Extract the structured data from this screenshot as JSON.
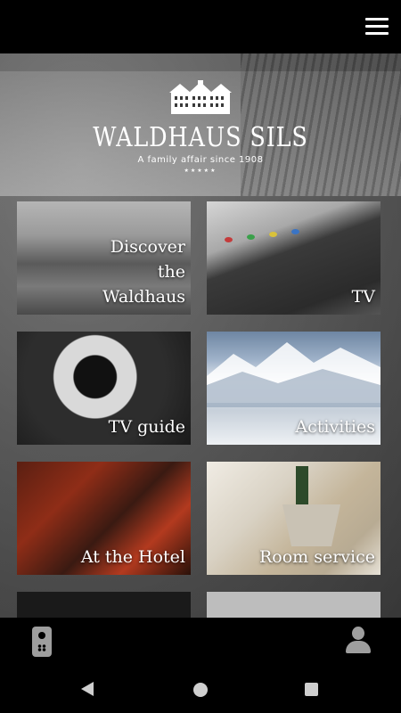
{
  "header": {
    "menu_icon": "hamburger-menu-icon"
  },
  "logo": {
    "brand": "WALDHAUS SILS",
    "tagline": "A family affair since 1908",
    "stars": "★★★★★"
  },
  "tiles": [
    {
      "label": "Discover the Waldhaus"
    },
    {
      "label": "TV"
    },
    {
      "label": "TV guide"
    },
    {
      "label": "Activities"
    },
    {
      "label": "At the Hotel"
    },
    {
      "label": "Room service"
    }
  ],
  "bottom_bar": {
    "left_icon": "remote-control-icon",
    "right_icon": "profile-icon"
  },
  "system_nav": {
    "back": "back-icon",
    "home": "home-icon",
    "recent": "recent-apps-icon"
  }
}
